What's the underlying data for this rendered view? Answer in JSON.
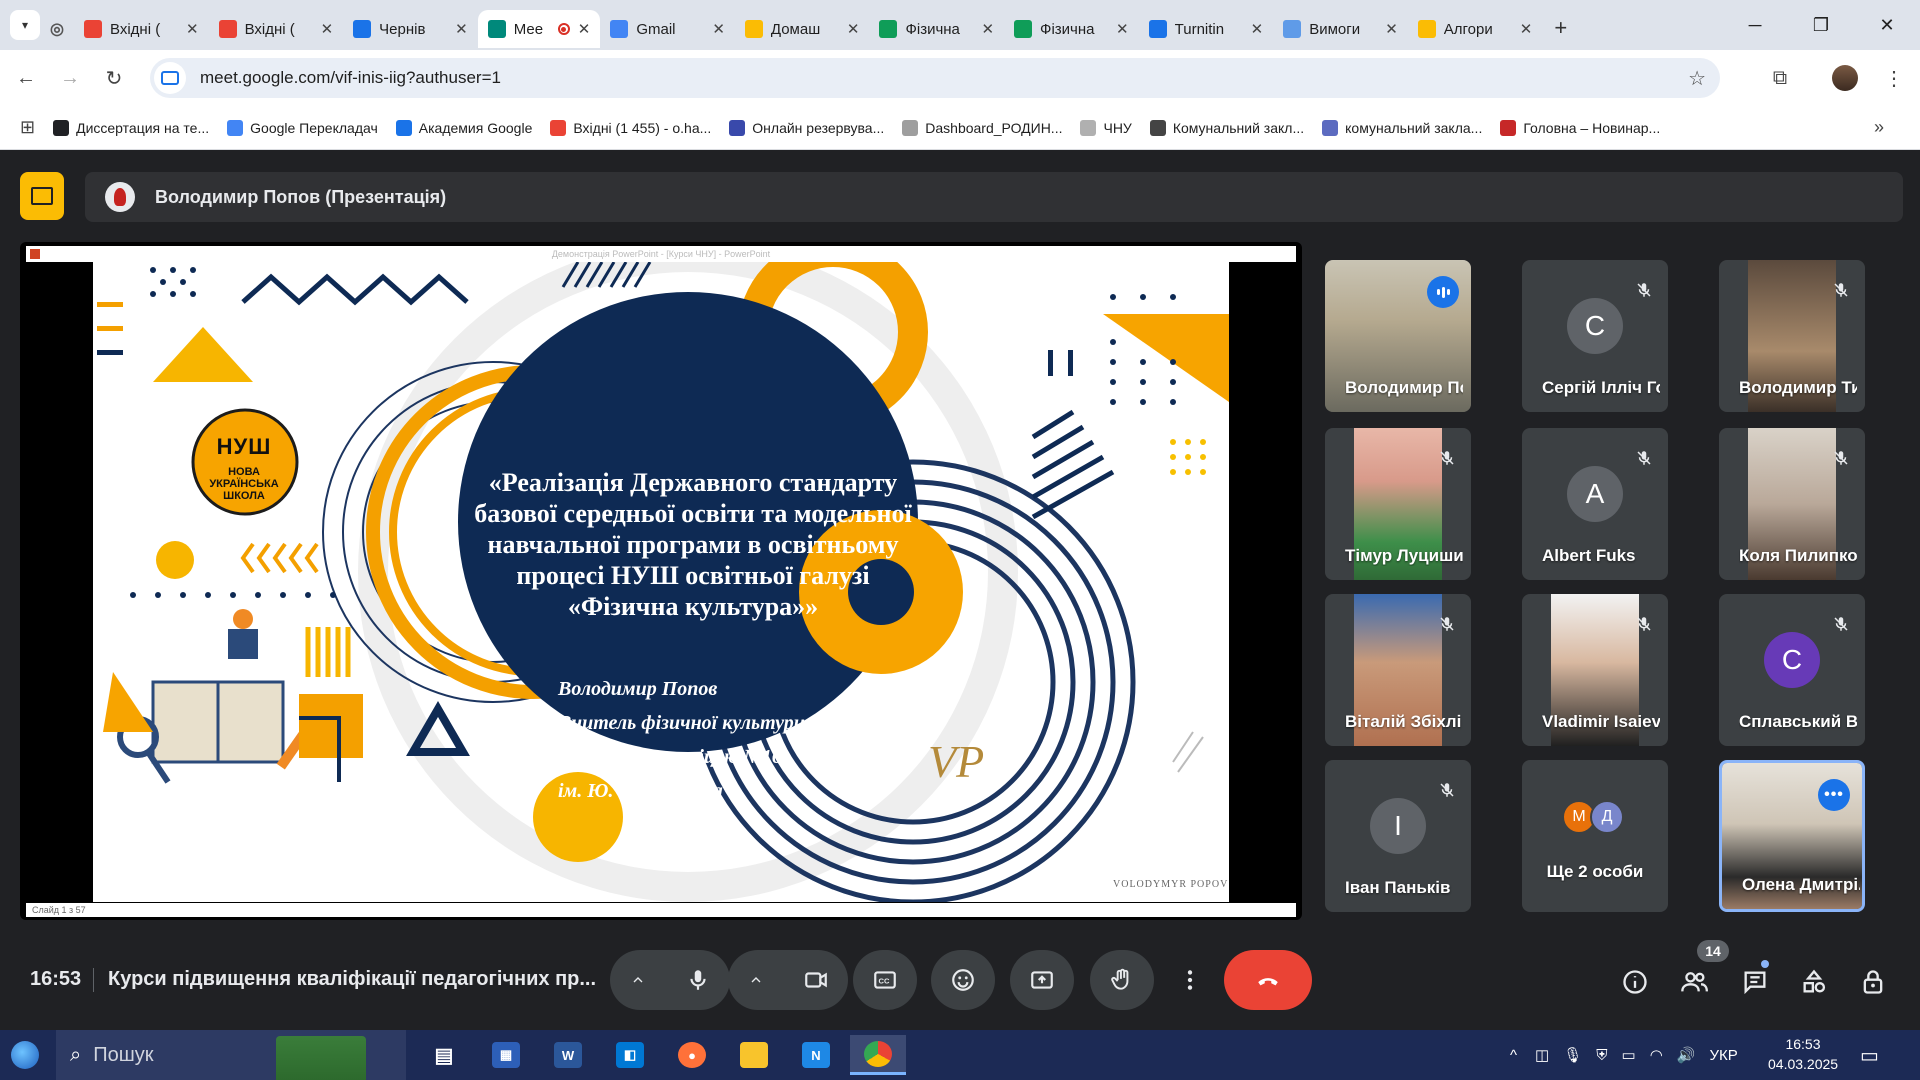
{
  "browser": {
    "tabs": [
      {
        "label": "Вхідні (",
        "icon": "gmail-icon",
        "color": "#ea4335"
      },
      {
        "label": "Вхідні (",
        "icon": "gmail-icon",
        "color": "#ea4335"
      },
      {
        "label": "Чернів",
        "icon": "calendar-icon",
        "color": "#1a73e8"
      },
      {
        "label": "Мее",
        "icon": "meet-icon",
        "color": "#00897b",
        "active": true,
        "recording": true
      },
      {
        "label": "Gmail",
        "icon": "google-icon",
        "color": "#4285f4"
      },
      {
        "label": "Домаш",
        "icon": "drive-icon",
        "color": "#fbbc04"
      },
      {
        "label": "Фізична",
        "icon": "sheets-icon",
        "color": "#0f9d58"
      },
      {
        "label": "Фізична",
        "icon": "sheets-icon",
        "color": "#0f9d58"
      },
      {
        "label": "Turnitin",
        "icon": "turnitin-icon",
        "color": "#1a73e8"
      },
      {
        "label": "Вимоги",
        "icon": "globe-icon",
        "color": "#5f9be8"
      },
      {
        "label": "Алгори",
        "icon": "drive-icon",
        "color": "#fbbc04"
      }
    ],
    "url": "meet.google.com/vif-inis-iig?authuser=1",
    "bookmarks": [
      {
        "label": "Диссертация на те...",
        "color": "#202124"
      },
      {
        "label": "Google Перекладач",
        "color": "#4285f4"
      },
      {
        "label": "Академия Google",
        "color": "#1a73e8"
      },
      {
        "label": "Вхідні (1 455) - o.ha...",
        "color": "#ea4335"
      },
      {
        "label": "Онлайн резервува...",
        "color": "#3949ab"
      },
      {
        "label": "Dashboard_РОДИН...",
        "color": "#9e9e9e"
      },
      {
        "label": "ЧНУ",
        "color": "#b0b0b0"
      },
      {
        "label": "Комунальний закл...",
        "color": "#444444"
      },
      {
        "label": "комунальний закла...",
        "color": "#5c6bc0"
      },
      {
        "label": "Головна – Новинар...",
        "color": "#c62828"
      }
    ]
  },
  "meet": {
    "presenter_label": "Володимир Попов (Презентація)",
    "ppt_window_title": "Демонстрація PowerPoint - [Курси ЧНУ] - PowerPoint",
    "ppt_slide_counter": "Слайд 1 з 57",
    "slide": {
      "title": "«Реалізація Державного стандарту базової середньої освіти та модельної навчальної програми в освітньому процесі НУШ освітньої галузі «Фізична культура»»",
      "author_lines": [
        "Володимир Попов",
        "Вчитель фізичної культури",
        "Чернівецького ліцею №16",
        "ім. Ю. Федьковича"
      ],
      "logo_text": "НУШ",
      "logo_sub": [
        "НОВА",
        "УКРАЇНСЬКА",
        "ШКОЛА"
      ],
      "brand_caption": "VOLODYMYR POPOV"
    },
    "participants": [
      {
        "name": "Володимир По...",
        "type": "video",
        "speaking": true
      },
      {
        "name": "Сергій Ілліч Го...",
        "type": "initial",
        "initial": "C",
        "color": "#5f6368",
        "muted": true
      },
      {
        "name": "Володимир Ти...",
        "type": "video",
        "muted": true
      },
      {
        "name": "Тімур Луцишин",
        "type": "video",
        "muted": true
      },
      {
        "name": "Albert Fuks",
        "type": "initial",
        "initial": "A",
        "color": "#5f6368",
        "muted": true
      },
      {
        "name": "Коля Пилипко",
        "type": "video",
        "muted": true
      },
      {
        "name": "Віталій Збіхлі",
        "type": "video",
        "muted": true
      },
      {
        "name": "Vladimir Isaiev",
        "type": "video",
        "muted": true
      },
      {
        "name": "Сплавський В...",
        "type": "initial",
        "initial": "С",
        "color": "#673ab7",
        "muted": true
      },
      {
        "name": "Іван Паньків",
        "type": "initial",
        "initial": "І",
        "color": "#5f6368",
        "muted": true
      },
      {
        "name": "Ще 2 особи",
        "type": "more",
        "initials": [
          "М",
          "Д"
        ],
        "colors": [
          "#e8710a",
          "#7986cb"
        ]
      },
      {
        "name": "Олена Дмитрі...",
        "type": "video",
        "selected": true
      }
    ],
    "time": "16:53",
    "meeting_title": "Курси підвищення кваліфікації педагогічних пр...",
    "participant_count": "14"
  },
  "taskbar": {
    "search_placeholder": "Пошук",
    "language": "УКР",
    "time": "16:53",
    "date": "04.03.2025"
  }
}
